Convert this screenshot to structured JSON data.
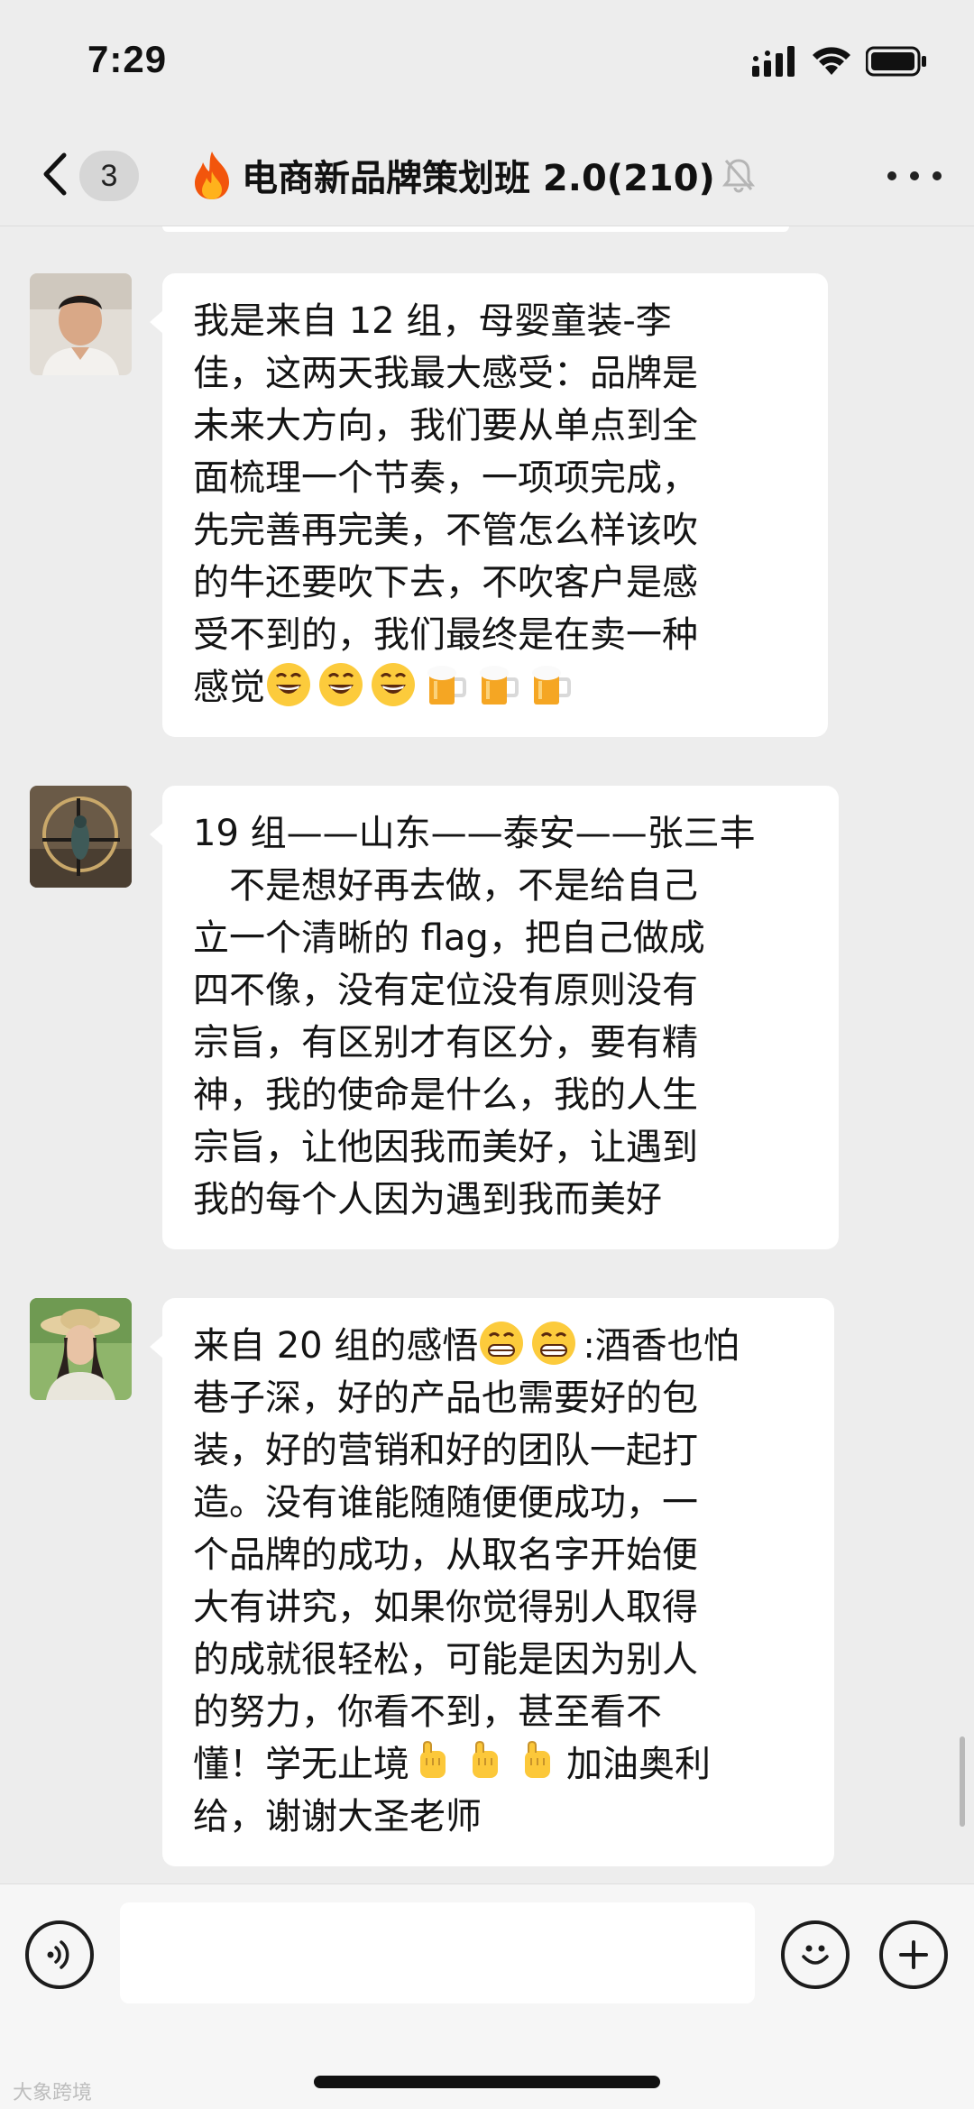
{
  "status_bar": {
    "time": "7:29"
  },
  "nav": {
    "unread_count": "3",
    "title": "电商新品牌策划班 2.0(210)"
  },
  "messages": [
    {
      "lines": [
        "我是来自 12 组，母婴童装-李",
        "佳，这两天我最大感受：品牌是",
        "未来大方向，我们要从单点到全",
        "面梳理一个节奏，一项项完成，",
        "先完善再完美，不管怎么样该吹",
        "的牛还要吹下去，不吹客户是感",
        "受不到的，我们最终是在卖一种",
        "感觉"
      ]
    },
    {
      "lines": [
        "19 组——山东——泰安——张三丰",
        "　不是想好再去做，不是给自己",
        "立一个清晰的 flag，把自己做成",
        "四不像，没有定位没有原则没有",
        "宗旨，有区别才有区分，要有精",
        "神，我的使命是什么，我的人生",
        "宗旨，让他因我而美好，让遇到",
        "我的每个人因为遇到我而美好"
      ]
    },
    {
      "lines": [
        "来自 20 组的感悟",
        ":酒香也怕",
        "巷子深，好的产品也需要好的包",
        "装，好的营销和好的团队一起打",
        "造。没有谁能随随便便成功，一",
        "个品牌的成功，从取名字开始便",
        "大有讲究，如果你觉得别人取得",
        "的成就很轻松，可能是因为别人",
        "的努力，你看不到，甚至看不",
        "懂！学无止境",
        "加油奥利",
        "给，谢谢大圣老师"
      ]
    }
  ],
  "watermark": "大象跨境"
}
